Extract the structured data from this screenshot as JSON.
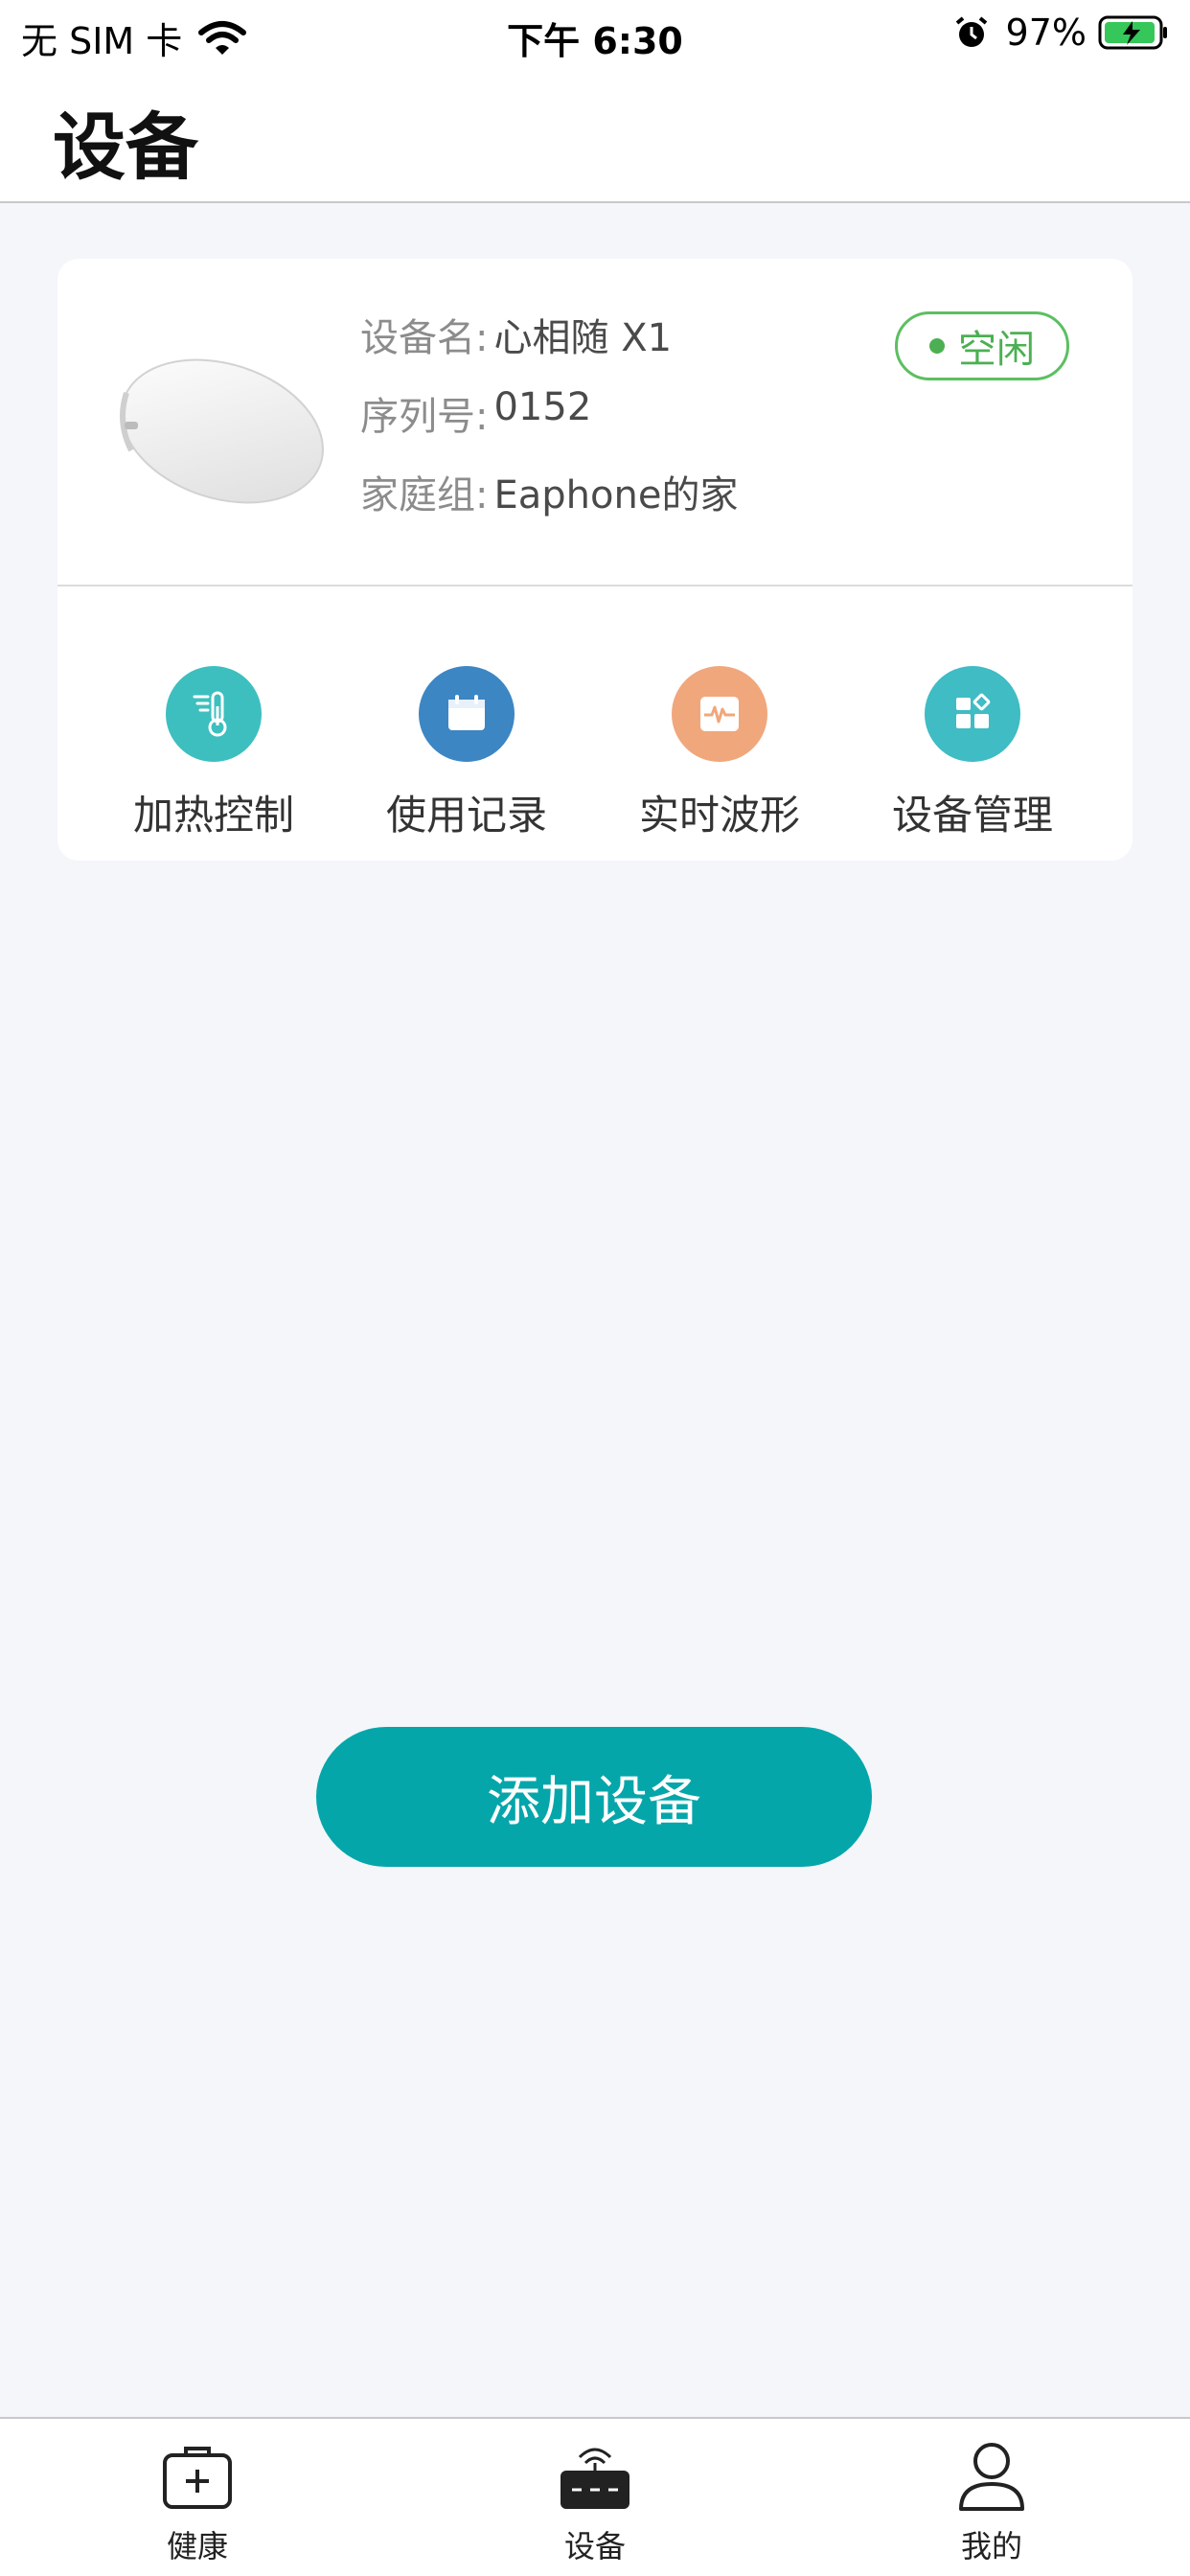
{
  "status_bar": {
    "carrier": "无 SIM 卡",
    "time": "下午 6:30",
    "battery": "97%"
  },
  "header": {
    "title": "设备"
  },
  "device": {
    "name_label": "设备名:",
    "name_value": "心相随 X1",
    "serial_label": "序列号:",
    "serial_value": "0152",
    "group_label": "家庭组:",
    "group_value": "Eaphone的家",
    "status": "空闲",
    "status_color": "#4cb052"
  },
  "actions": [
    {
      "label": "加热控制",
      "icon": "thermometer-icon",
      "color": "#3dbfbf"
    },
    {
      "label": "使用记录",
      "icon": "calendar-icon",
      "color": "#3c86c4"
    },
    {
      "label": "实时波形",
      "icon": "waveform-icon",
      "color": "#f0a77c"
    },
    {
      "label": "设备管理",
      "icon": "grid-icon",
      "color": "#3fbcc4"
    }
  ],
  "add_button": {
    "label": "添加设备",
    "color": "#04a6aa"
  },
  "tabs": [
    {
      "label": "健康",
      "icon": "medical-kit-icon"
    },
    {
      "label": "设备",
      "icon": "router-icon",
      "active": true
    },
    {
      "label": "我的",
      "icon": "person-icon"
    }
  ]
}
